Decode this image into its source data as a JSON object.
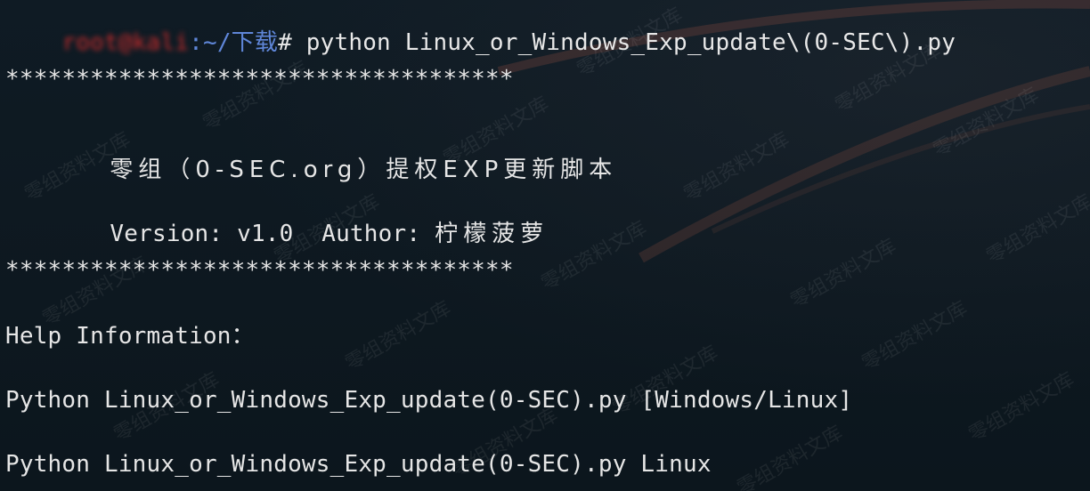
{
  "prompt": {
    "user_host": "root@kali",
    "path": ":~/下载",
    "symbol": "#",
    "command": " python Linux_or_Windows_Exp_update\\(0-SEC\\).py"
  },
  "output": {
    "separator": "************************************",
    "title": "零组（0-SEC.org）提权EXP更新脚本",
    "version_label": "Version: v1.0  Author: ",
    "author": "柠檬菠萝",
    "help_header": "Help Information：",
    "usage_1": "Python Linux_or_Windows_Exp_update(0-SEC).py [Windows/Linux]",
    "usage_2": "Python Linux_or_Windows_Exp_update(0-SEC).py Linux"
  },
  "watermark": {
    "text": "零组资料文库"
  },
  "colors": {
    "background": "#0f1a22",
    "text": "#e6e6e6",
    "prompt_user": "#cc2b2b",
    "prompt_path": "#5f86d8"
  }
}
